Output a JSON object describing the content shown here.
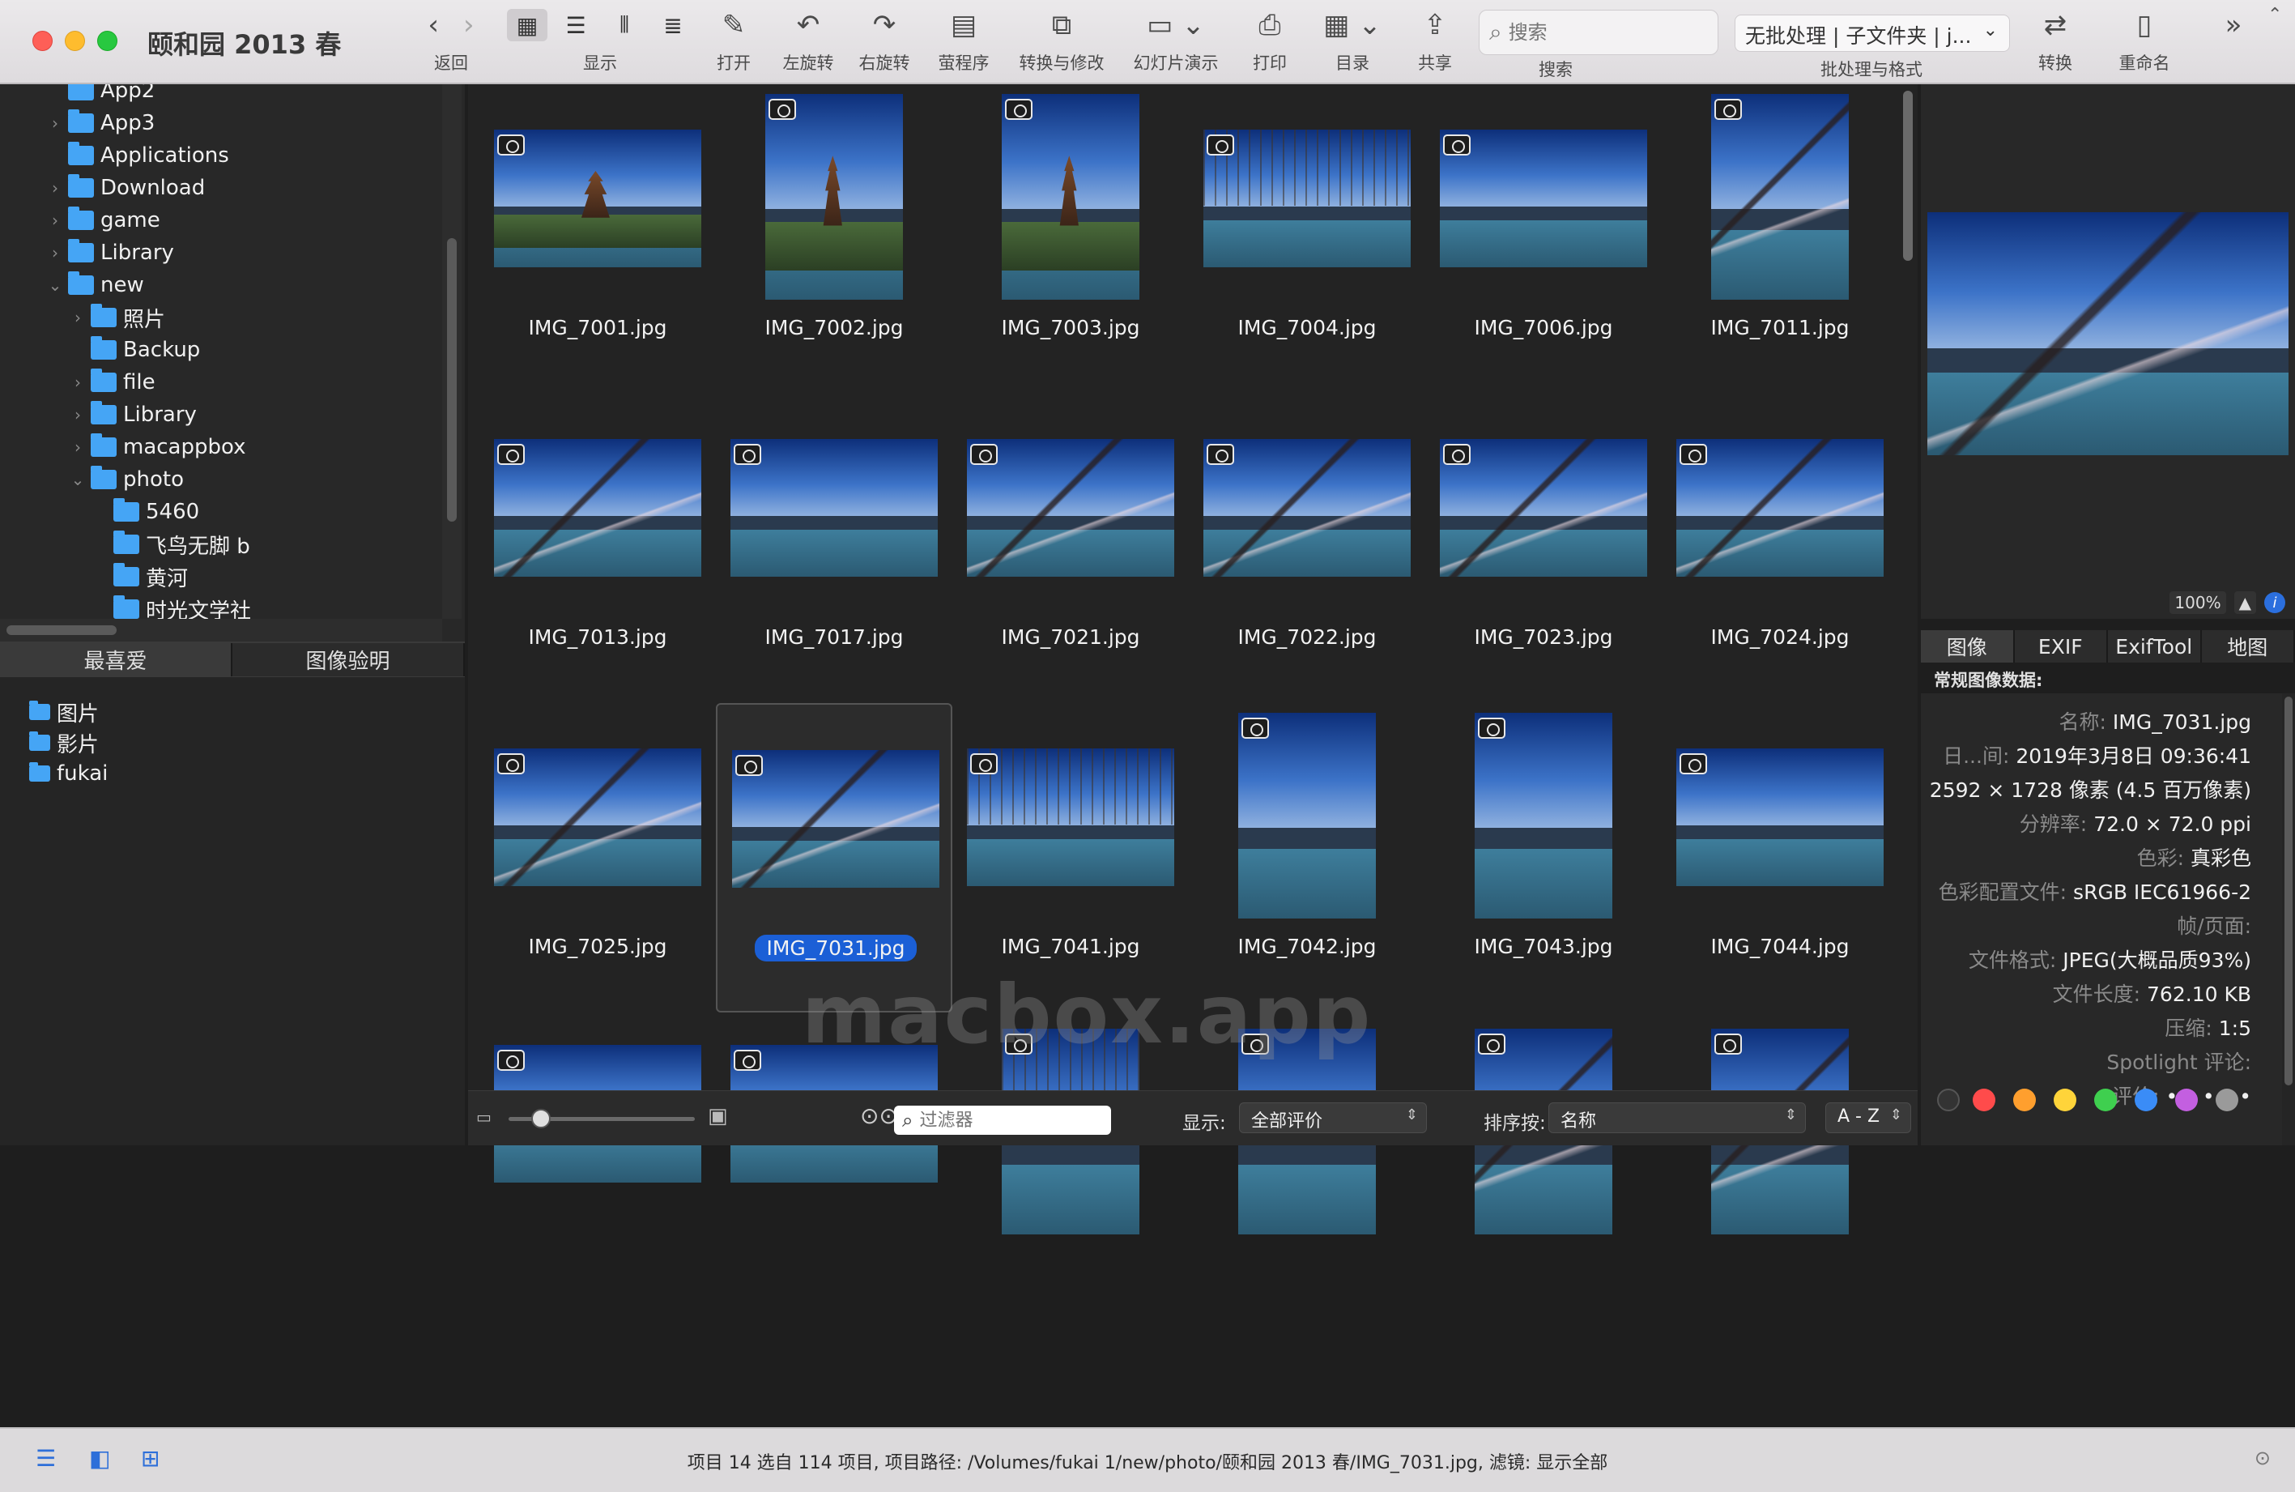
{
  "window": {
    "title": "颐和园 2013 春"
  },
  "toolbar": {
    "back_label": "返回",
    "display_label": "显示",
    "open_label": "打开",
    "rotate_left_label": "左旋转",
    "rotate_right_label": "右旋转",
    "slideshow_program_label": "萤程序",
    "convert_modify_label": "转换与修改",
    "slideshow_label": "幻灯片演示",
    "print_label": "打印",
    "catalog_label": "目录",
    "share_label": "共享",
    "search_placeholder": "搜索",
    "search_label": "搜索",
    "batch_value": "无批处理 | 子文件夹 | j...",
    "batch_label": "批处理与格式",
    "convert_label": "转换",
    "rename_label": "重命名"
  },
  "tree": [
    {
      "label": "App2",
      "depth": 0,
      "expand": ""
    },
    {
      "label": "App3",
      "depth": 0,
      "expand": "›"
    },
    {
      "label": "Applications",
      "depth": 0,
      "expand": ""
    },
    {
      "label": "Download",
      "depth": 0,
      "expand": "›"
    },
    {
      "label": "game",
      "depth": 0,
      "expand": "›"
    },
    {
      "label": "Library",
      "depth": 0,
      "expand": "›"
    },
    {
      "label": "new",
      "depth": 0,
      "expand": "⌄"
    },
    {
      "label": "照片",
      "depth": 1,
      "expand": "›"
    },
    {
      "label": "Backup",
      "depth": 1,
      "expand": ""
    },
    {
      "label": "file",
      "depth": 1,
      "expand": "›"
    },
    {
      "label": "Library",
      "depth": 1,
      "expand": "›"
    },
    {
      "label": "macappbox",
      "depth": 1,
      "expand": "›"
    },
    {
      "label": "photo",
      "depth": 1,
      "expand": "⌄"
    },
    {
      "label": "5460",
      "depth": 2,
      "expand": ""
    },
    {
      "label": "飞鸟无脚 b",
      "depth": 2,
      "expand": ""
    },
    {
      "label": "黄河",
      "depth": 2,
      "expand": ""
    },
    {
      "label": "时光文学社",
      "depth": 2,
      "expand": ""
    }
  ],
  "favorites": {
    "tab_favorites": "最喜爱",
    "tab_image_check": "图像验明",
    "items": [
      "图片",
      "影片",
      "fukai"
    ]
  },
  "thumbnails": [
    {
      "name": "IMG_7001.jpg",
      "style": "pagoda",
      "orient": "landscape"
    },
    {
      "name": "IMG_7002.jpg",
      "style": "pagoda",
      "orient": "portrait"
    },
    {
      "name": "IMG_7003.jpg",
      "style": "pagoda",
      "orient": "portrait"
    },
    {
      "name": "IMG_7004.jpg",
      "style": "willow",
      "orient": "landscape"
    },
    {
      "name": "IMG_7006.jpg",
      "style": "lake",
      "orient": "landscape"
    },
    {
      "name": "IMG_7011.jpg",
      "style": "branch",
      "orient": "portrait"
    },
    {
      "name": "IMG_7013.jpg",
      "style": "branch",
      "orient": "landscape"
    },
    {
      "name": "IMG_7017.jpg",
      "style": "lake",
      "orient": "landscape"
    },
    {
      "name": "IMG_7021.jpg",
      "style": "branch",
      "orient": "landscape"
    },
    {
      "name": "IMG_7022.jpg",
      "style": "branch",
      "orient": "landscape"
    },
    {
      "name": "IMG_7023.jpg",
      "style": "branch",
      "orient": "landscape"
    },
    {
      "name": "IMG_7024.jpg",
      "style": "branch",
      "orient": "landscape"
    },
    {
      "name": "IMG_7025.jpg",
      "style": "branch",
      "orient": "landscape"
    },
    {
      "name": "IMG_7031.jpg",
      "style": "branch",
      "orient": "landscape",
      "selected": true
    },
    {
      "name": "IMG_7041.jpg",
      "style": "willow",
      "orient": "landscape"
    },
    {
      "name": "IMG_7042.jpg",
      "style": "lake",
      "orient": "portrait"
    },
    {
      "name": "IMG_7043.jpg",
      "style": "lake",
      "orient": "portrait"
    },
    {
      "name": "IMG_7044.jpg",
      "style": "lake",
      "orient": "landscape"
    },
    {
      "name": "",
      "style": "lake",
      "orient": "landscape"
    },
    {
      "name": "",
      "style": "lake",
      "orient": "landscape"
    },
    {
      "name": "",
      "style": "willow",
      "orient": "portrait"
    },
    {
      "name": "",
      "style": "lake",
      "orient": "portrait"
    },
    {
      "name": "",
      "style": "branch",
      "orient": "portrait"
    },
    {
      "name": "",
      "style": "branch",
      "orient": "portrait"
    }
  ],
  "watermark": "macbox.app",
  "grid_bottom": {
    "filter_placeholder": "过滤器",
    "display_label": "显示:",
    "display_value": "全部评价",
    "sort_label": "排序按:",
    "sort_value": "名称",
    "order_value": "A - Z"
  },
  "preview": {
    "zoom": "100%"
  },
  "meta_tabs": [
    "图像",
    "EXIF",
    "ExifTool",
    "地图"
  ],
  "meta_header": "常规图像数据:",
  "metadata": [
    {
      "k": "名称:",
      "v": "IMG_7031.jpg"
    },
    {
      "k": "日...间:",
      "v": "2019年3月8日 09:36:41"
    },
    {
      "k": ":",
      "v": "2592 × 1728 像素 (4.5 百万像素)"
    },
    {
      "k": "分辨率:",
      "v": "72.0 × 72.0 ppi"
    },
    {
      "k": "色彩:",
      "v": "真彩色"
    },
    {
      "k": "色彩配置文件:",
      "v": "sRGB IEC61966-2"
    },
    {
      "k": "帧/页面:",
      "v": ""
    },
    {
      "k": "文件格式:",
      "v": "JPEG(大概品质93%)"
    },
    {
      "k": "文件长度:",
      "v": "762.10 KB"
    },
    {
      "k": "压缩:",
      "v": "1:5"
    },
    {
      "k": "Spotlight 评论:",
      "v": ""
    },
    {
      "k": "评价:",
      "v": "• • • • •"
    }
  ],
  "color_labels": [
    "#ff4b4b",
    "#ff9f2e",
    "#ffd43a",
    "#3fcf4f",
    "#3a8cf7",
    "#c35fe0",
    "#9a9a9a"
  ],
  "status": {
    "text": "项目 14 选自 114 项目, 项目路径: /Volumes/fukai 1/new/photo/颐和园 2013 春/IMG_7031.jpg, 滤镜: 显示全部"
  }
}
